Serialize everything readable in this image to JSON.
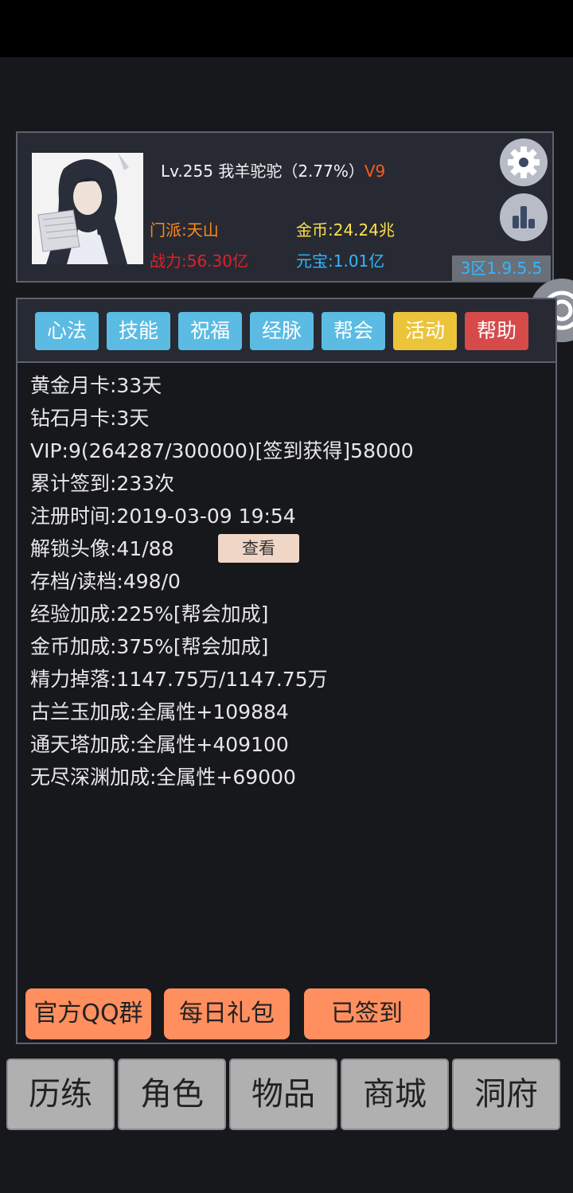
{
  "profile": {
    "level_name": "Lv.255 我羊驼驼（2.77%）",
    "vip": "V9",
    "sect": "门派:天山",
    "gold": "金币:24.24兆",
    "power": "战力:56.30亿",
    "yuanbao": "元宝:1.01亿",
    "server": "3区1.9.5.5"
  },
  "icons": {
    "settings": "gear-icon",
    "ranking": "bar-chart-icon",
    "floating": "target-icon"
  },
  "tabs": [
    {
      "label": "心法",
      "color": "#5bbbe3"
    },
    {
      "label": "技能",
      "color": "#5bbbe3"
    },
    {
      "label": "祝福",
      "color": "#5bbbe3"
    },
    {
      "label": "经脉",
      "color": "#5bbbe3"
    },
    {
      "label": "帮会",
      "color": "#5bbbe3"
    },
    {
      "label": "活动",
      "color": "#ecc43a"
    },
    {
      "label": "帮助",
      "color": "#d64a4a"
    }
  ],
  "info_lines": [
    "黄金月卡:33天",
    "钻石月卡:3天",
    "VIP:9(264287/300000)[签到获得]58000",
    "累计签到:233次",
    "注册时间:2019-03-09 19:54",
    "解锁头像:41/88",
    "存档/读档:498/0",
    "经验加成:225%[帮会加成]",
    "金币加成:375%[帮会加成]",
    "精力掉落:1147.75万/1147.75万",
    "古兰玉加成:全属性+109884",
    "通天塔加成:全属性+409100",
    "无尽深渊加成:全属性+69000"
  ],
  "view_button": "查看",
  "actions": {
    "qq_group": "官方QQ群",
    "daily_gift": "每日礼包",
    "signed": "已签到"
  },
  "nav": [
    "历练",
    "角色",
    "物品",
    "商城",
    "洞府"
  ]
}
